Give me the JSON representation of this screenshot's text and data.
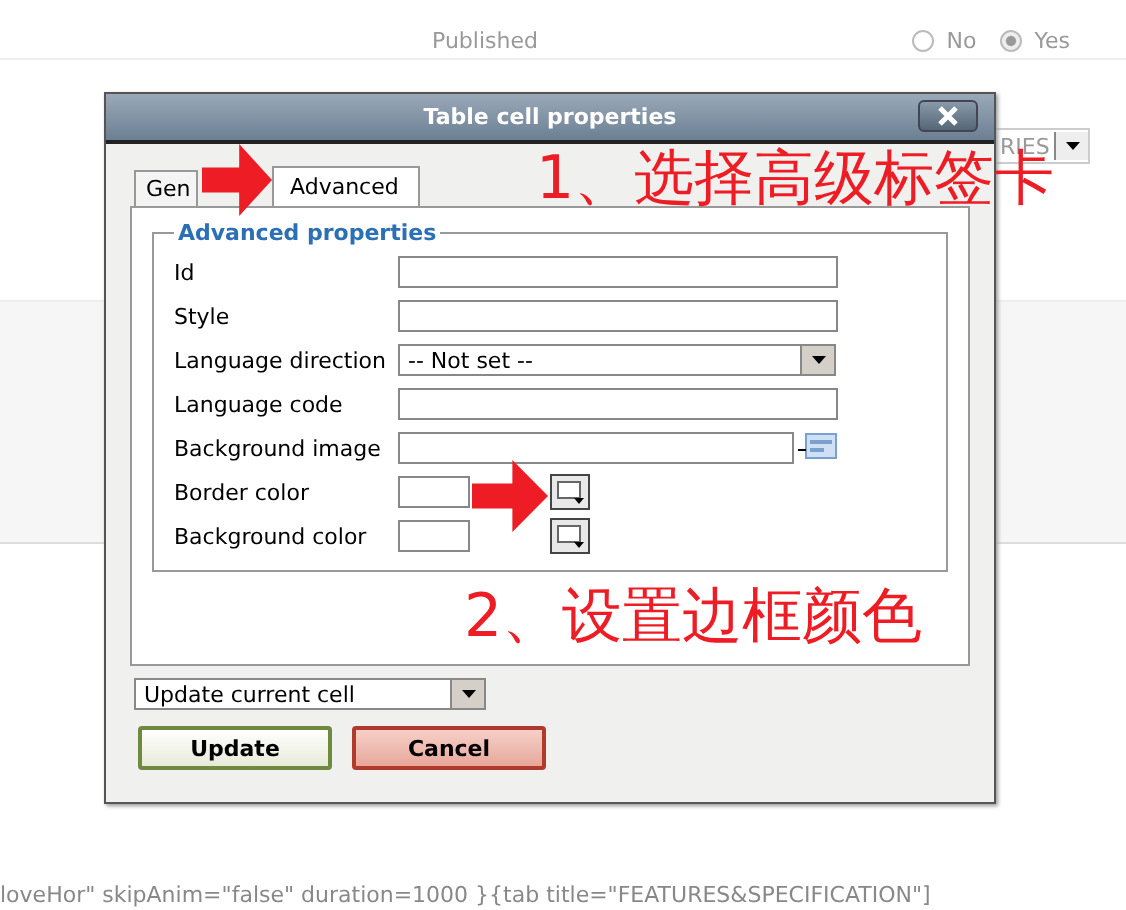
{
  "page": {
    "published": {
      "label": "Published",
      "options": [
        {
          "label": "No",
          "selected": false
        },
        {
          "label": "Yes",
          "selected": true
        }
      ]
    },
    "category_select": {
      "value": "RIES"
    },
    "code_line": "loveHor\" skipAnim=\"false\" duration=1000 }{tab title=\"FEATURES&SPECIFICATION\"]"
  },
  "dialog": {
    "title": "Table cell properties",
    "tabs": [
      {
        "label": "Gen",
        "selected": false
      },
      {
        "label": "Advanced",
        "selected": true
      }
    ],
    "legend": "Advanced properties",
    "fields": [
      {
        "label": "Id",
        "kind": "text"
      },
      {
        "label": "Style",
        "kind": "text"
      },
      {
        "label": "Language direction",
        "kind": "select",
        "value": "-- Not set --"
      },
      {
        "label": "Language code",
        "kind": "text"
      },
      {
        "label": "Background image",
        "kind": "browse"
      },
      {
        "label": "Border color",
        "kind": "color"
      },
      {
        "label": "Background color",
        "kind": "color"
      }
    ],
    "action_select": {
      "value": "Update current cell"
    },
    "buttons": [
      {
        "label": "Update",
        "kind": "confirm"
      },
      {
        "label": "Cancel",
        "kind": "cancel"
      }
    ]
  },
  "annotations": [
    {
      "text": "1、选择高级标签卡"
    },
    {
      "text": "2、设置边框颜色"
    }
  ]
}
